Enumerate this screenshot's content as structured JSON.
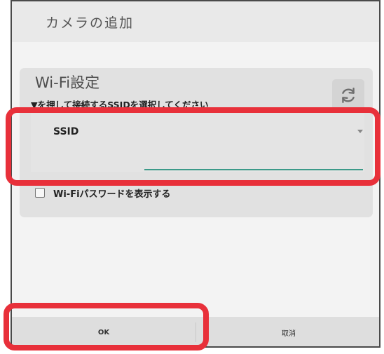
{
  "dialog": {
    "title": "カメラの追加"
  },
  "wifi_panel": {
    "heading": "Wi-Fi設定",
    "instruction": "▼を押して接続するSSIDを選択してください",
    "ssid_label": "SSID",
    "show_password_label": "Wi-Fiパスワードを表示する",
    "show_password_checked": false
  },
  "buttons": {
    "ok_label": "OK",
    "cancel_label": "取消"
  },
  "colors": {
    "highlight": "#e8303a",
    "input_underline": "#3c9a89"
  }
}
